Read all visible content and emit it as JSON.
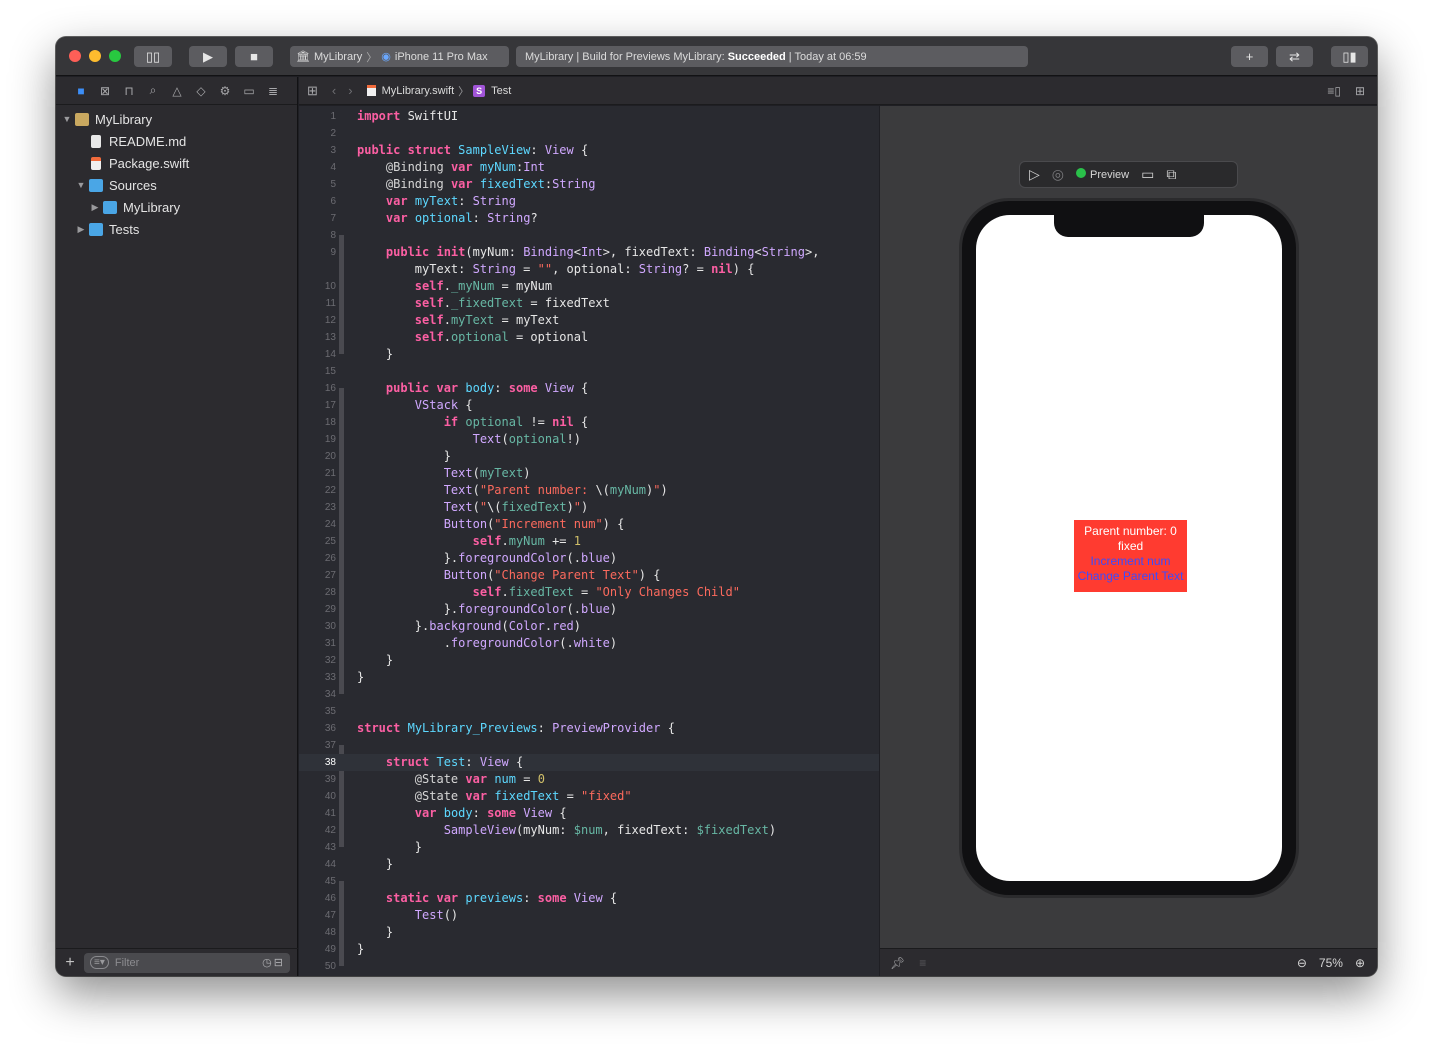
{
  "toolbar": {
    "scheme_project": "MyLibrary",
    "scheme_device": "iPhone 11 Pro Max",
    "activity_prefix": "MyLibrary | Build for Previews MyLibrary:",
    "activity_status": "Succeeded",
    "activity_time": "| Today at 06:59"
  },
  "navigator": {
    "filter_placeholder": "Filter",
    "items": [
      {
        "label": "MyLibrary",
        "indent": 0,
        "disclosure": "▼",
        "icon": "package-icon"
      },
      {
        "label": "README.md",
        "indent": 1,
        "disclosure": "",
        "icon": "document-icon"
      },
      {
        "label": "Package.swift",
        "indent": 1,
        "disclosure": "",
        "icon": "swift-file-icon"
      },
      {
        "label": "Sources",
        "indent": 1,
        "disclosure": "▼",
        "icon": "folder-icon"
      },
      {
        "label": "MyLibrary",
        "indent": 2,
        "disclosure": "▶",
        "icon": "folder-icon"
      },
      {
        "label": "Tests",
        "indent": 1,
        "disclosure": "▶",
        "icon": "folder-icon"
      }
    ]
  },
  "jumpbar": {
    "file": "MyLibrary.swift",
    "symbol": "Test"
  },
  "editor": {
    "current_line": 38,
    "lines": [
      {
        "n": "1",
        "h": "<span class='kw'>import</span> SwiftUI"
      },
      {
        "n": "2",
        "h": ""
      },
      {
        "n": "3",
        "h": "<span class='kw'>public struct</span> <span class='dec'>SampleView</span>: <span class='ty'>View</span> {"
      },
      {
        "n": "4",
        "h": "    <span class='at'>@Binding</span> <span class='kw'>var</span> <span class='dec'>myNum</span>:<span class='ty'>Int</span>"
      },
      {
        "n": "5",
        "h": "    <span class='at'>@Binding</span> <span class='kw'>var</span> <span class='dec'>fixedText</span>:<span class='ty'>String</span>"
      },
      {
        "n": "6",
        "h": "    <span class='kw'>var</span> <span class='dec'>myText</span>: <span class='ty'>String</span>"
      },
      {
        "n": "7",
        "h": "    <span class='kw'>var</span> <span class='dec'>optional</span>: <span class='ty'>String</span>?"
      },
      {
        "n": "8",
        "h": ""
      },
      {
        "n": "9",
        "h": "    <span class='kw'>public init</span>(myNum: <span class='ty'>Binding</span>&lt;<span class='ty'>Int</span>&gt;, fixedText: <span class='ty'>Binding</span>&lt;<span class='ty'>String</span>&gt;,"
      },
      {
        "n": "",
        "h": "        myText: <span class='ty'>String</span> = <span class='st'>\"\"</span>, optional: <span class='ty'>String</span>? = <span class='kw'>nil</span>) {"
      },
      {
        "n": "10",
        "h": "        <span class='kw'>self</span>.<span class='pr'>_myNum</span> = myNum"
      },
      {
        "n": "11",
        "h": "        <span class='kw'>self</span>.<span class='pr'>_fixedText</span> = fixedText"
      },
      {
        "n": "12",
        "h": "        <span class='kw'>self</span>.<span class='pr'>myText</span> = myText"
      },
      {
        "n": "13",
        "h": "        <span class='kw'>self</span>.<span class='pr'>optional</span> = optional"
      },
      {
        "n": "14",
        "h": "    }"
      },
      {
        "n": "15",
        "h": ""
      },
      {
        "n": "16",
        "h": "    <span class='kw'>public var</span> <span class='dec'>body</span>: <span class='kw'>some</span> <span class='ty'>View</span> {"
      },
      {
        "n": "17",
        "h": "        <span class='ty'>VStack</span> {"
      },
      {
        "n": "18",
        "h": "            <span class='kw'>if</span> <span class='pr'>optional</span> != <span class='kw'>nil</span> {"
      },
      {
        "n": "19",
        "h": "                <span class='ty'>Text</span>(<span class='pr'>optional</span>!)"
      },
      {
        "n": "20",
        "h": "            }"
      },
      {
        "n": "21",
        "h": "            <span class='ty'>Text</span>(<span class='pr'>myText</span>)"
      },
      {
        "n": "22",
        "h": "            <span class='ty'>Text</span>(<span class='st'>\"Parent number: </span>\\(<span class='pr'>myNum</span>)<span class='st'>\"</span>)"
      },
      {
        "n": "23",
        "h": "            <span class='ty'>Text</span>(<span class='st'>\"</span>\\(<span class='pr'>fixedText</span>)<span class='st'>\"</span>)"
      },
      {
        "n": "24",
        "h": "            <span class='ty'>Button</span>(<span class='st'>\"Increment num\"</span>) {"
      },
      {
        "n": "25",
        "h": "                <span class='kw'>self</span>.<span class='pr'>myNum</span> += <span class='nu'>1</span>"
      },
      {
        "n": "26",
        "h": "            }.<span class='ty'>foregroundColor</span>(.<span class='ty'>blue</span>)"
      },
      {
        "n": "27",
        "h": "            <span class='ty'>Button</span>(<span class='st'>\"Change Parent Text\"</span>) {"
      },
      {
        "n": "28",
        "h": "                <span class='kw'>self</span>.<span class='pr'>fixedText</span> = <span class='st'>\"Only Changes Child\"</span>"
      },
      {
        "n": "29",
        "h": "            }.<span class='ty'>foregroundColor</span>(.<span class='ty'>blue</span>)"
      },
      {
        "n": "30",
        "h": "        }.<span class='ty'>background</span>(<span class='ty'>Color</span>.<span class='ty'>red</span>)"
      },
      {
        "n": "31",
        "h": "            .<span class='ty'>foregroundColor</span>(.<span class='ty'>white</span>)"
      },
      {
        "n": "32",
        "h": "    }"
      },
      {
        "n": "33",
        "h": "}"
      },
      {
        "n": "34",
        "h": ""
      },
      {
        "n": "35",
        "h": ""
      },
      {
        "n": "36",
        "h": "<span class='kw'>struct</span> <span class='dec'>MyLibrary_Previews</span>: <span class='ty'>PreviewProvider</span> {"
      },
      {
        "n": "37",
        "h": ""
      },
      {
        "n": "38",
        "h": "    <span class='kw'>struct</span> <span class='dec'>Test</span>: <span class='ty'>View</span> {"
      },
      {
        "n": "39",
        "h": "        <span class='at'>@State</span> <span class='kw'>var</span> <span class='dec'>num</span> = <span class='nu'>0</span>"
      },
      {
        "n": "40",
        "h": "        <span class='at'>@State</span> <span class='kw'>var</span> <span class='dec'>fixedText</span> = <span class='st'>\"fixed\"</span>"
      },
      {
        "n": "41",
        "h": "        <span class='kw'>var</span> <span class='dec'>body</span>: <span class='kw'>some</span> <span class='ty'>View</span> {"
      },
      {
        "n": "42",
        "h": "            <span class='ty'>SampleView</span>(myNum: <span class='pr'>$num</span>, fixedText: <span class='pr'>$fixedText</span>)"
      },
      {
        "n": "43",
        "h": "        }"
      },
      {
        "n": "44",
        "h": "    }"
      },
      {
        "n": "45",
        "h": ""
      },
      {
        "n": "46",
        "h": "    <span class='kw'>static var</span> <span class='dec'>previews</span>: <span class='kw'>some</span> <span class='ty'>View</span> {"
      },
      {
        "n": "47",
        "h": "        <span class='ty'>Test</span>()"
      },
      {
        "n": "48",
        "h": "    }"
      },
      {
        "n": "49",
        "h": "}"
      },
      {
        "n": "50",
        "h": ""
      }
    ]
  },
  "preview": {
    "label": "Preview",
    "rendered_lines": [
      "Parent number: 0",
      "fixed"
    ],
    "buttons": [
      "Increment num",
      "Change Parent Text"
    ],
    "zoom": "75%",
    "colors": {
      "background": "#ff3b30",
      "text": "#ffffff",
      "button": "#3a4cff"
    }
  }
}
